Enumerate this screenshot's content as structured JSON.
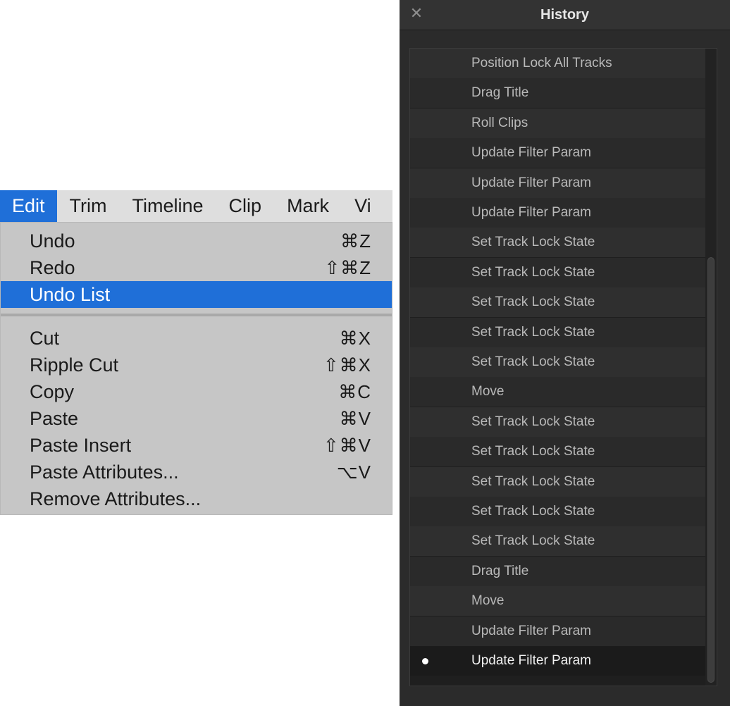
{
  "menubar": {
    "items": [
      "Edit",
      "Trim",
      "Timeline",
      "Clip",
      "Mark",
      "Vi"
    ]
  },
  "edit_menu": {
    "items": [
      {
        "label": "Undo",
        "shortcut": "⌘Z"
      },
      {
        "label": "Redo",
        "shortcut": "⇧⌘Z"
      },
      {
        "label": "Undo List",
        "shortcut": ""
      },
      {
        "label": "Cut",
        "shortcut": "⌘X"
      },
      {
        "label": "Ripple Cut",
        "shortcut": "⇧⌘X"
      },
      {
        "label": "Copy",
        "shortcut": "⌘C"
      },
      {
        "label": "Paste",
        "shortcut": "⌘V"
      },
      {
        "label": "Paste Insert",
        "shortcut": "⇧⌘V"
      },
      {
        "label": "Paste Attributes...",
        "shortcut": "⌥V"
      },
      {
        "label": "Remove Attributes...",
        "shortcut": ""
      }
    ],
    "highlighted": "Undo List"
  },
  "history": {
    "title": "History",
    "close_icon": "close-icon",
    "items": [
      "Position Lock All Tracks",
      "Drag Title",
      "Roll Clips",
      "Update Filter Param",
      "Update Filter Param",
      "Update Filter Param",
      "Set Track Lock State",
      "Set Track Lock State",
      "Set Track Lock State",
      "Set Track Lock State",
      "Set Track Lock State",
      "Move",
      "Set Track Lock State",
      "Set Track Lock State",
      "Set Track Lock State",
      "Set Track Lock State",
      "Set Track Lock State",
      "Drag Title",
      "Move",
      "Update Filter Param",
      "Update Filter Param"
    ],
    "current_index": 20
  },
  "colors": {
    "menu_highlight": "#1f6fd8",
    "panel_bg": "#2b2b2b",
    "current_dot": "#ffffff"
  }
}
